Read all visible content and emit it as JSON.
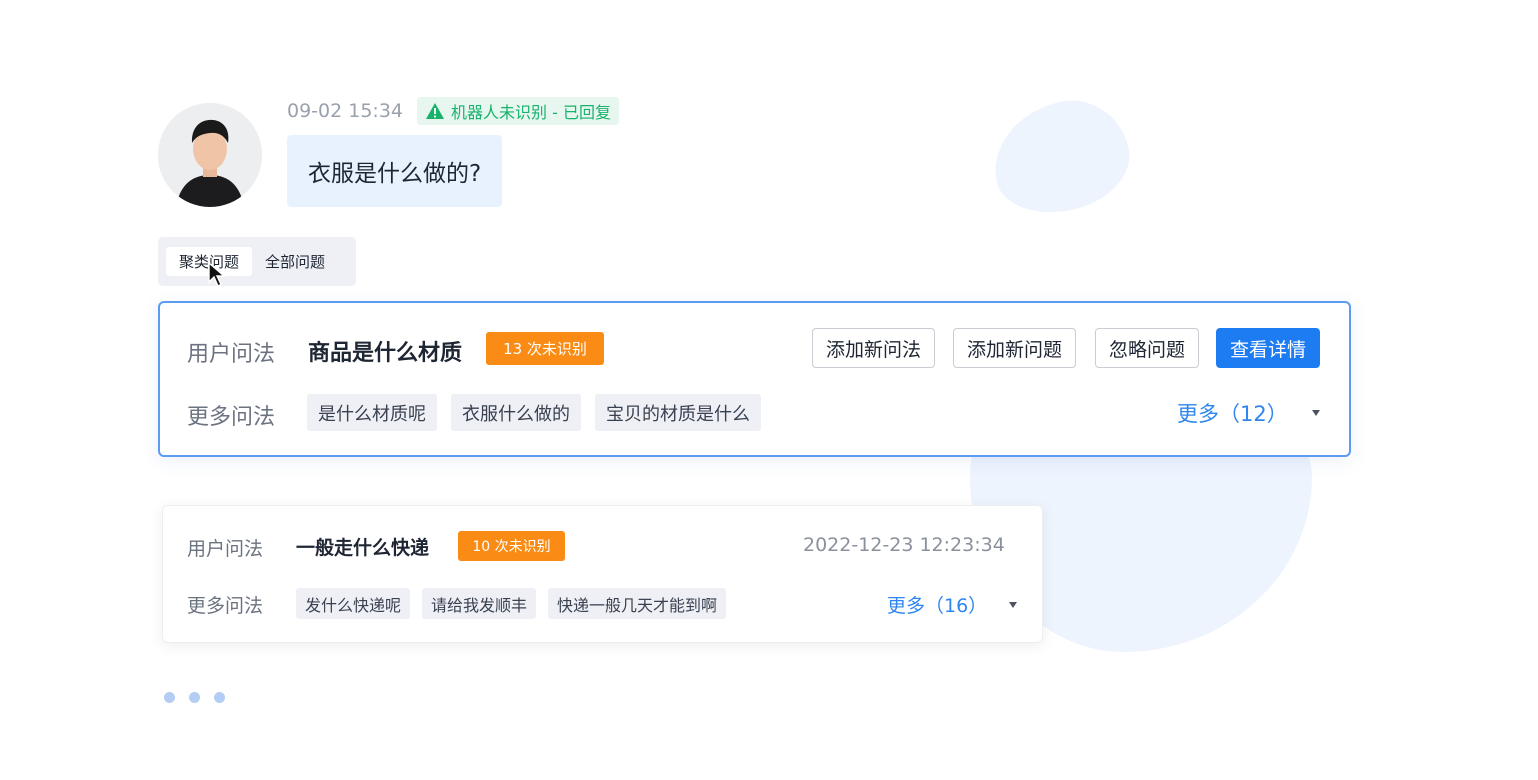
{
  "message": {
    "time": "09-02 15:34",
    "status": "机器人未识别 - 已回复",
    "text": "衣服是什么做的?"
  },
  "tabs": [
    {
      "label": "聚类问题",
      "active": true
    },
    {
      "label": "全部问题",
      "active": false
    }
  ],
  "cards": [
    {
      "label": "用户问法",
      "question": "商品是什么材质",
      "badge": "13 次未识别",
      "actions": [
        "添加新问法",
        "添加新问题",
        "忽略问题",
        "查看详情"
      ],
      "more_label": "更多问法",
      "chips": [
        "是什么材质呢",
        "衣服什么做的",
        "宝贝的材质是什么"
      ],
      "more_link": "更多（12）"
    },
    {
      "label": "用户问法",
      "question": "一般走什么快递",
      "badge": "10 次未识别",
      "timestamp": "2022-12-23 12:23:34",
      "more_label": "更多问法",
      "chips": [
        "发什么快递呢",
        "请给我发顺丰",
        "快递一般几天才能到啊"
      ],
      "more_link": "更多（16）"
    }
  ],
  "colors": {
    "primary": "#1e7cf2",
    "badge_orange": "#fa8c16",
    "status_green": "#18b26b",
    "link_blue": "#2f86ee"
  },
  "icons": [
    "warning-triangle-icon",
    "mouse-cursor-icon",
    "caret-down-icon"
  ]
}
